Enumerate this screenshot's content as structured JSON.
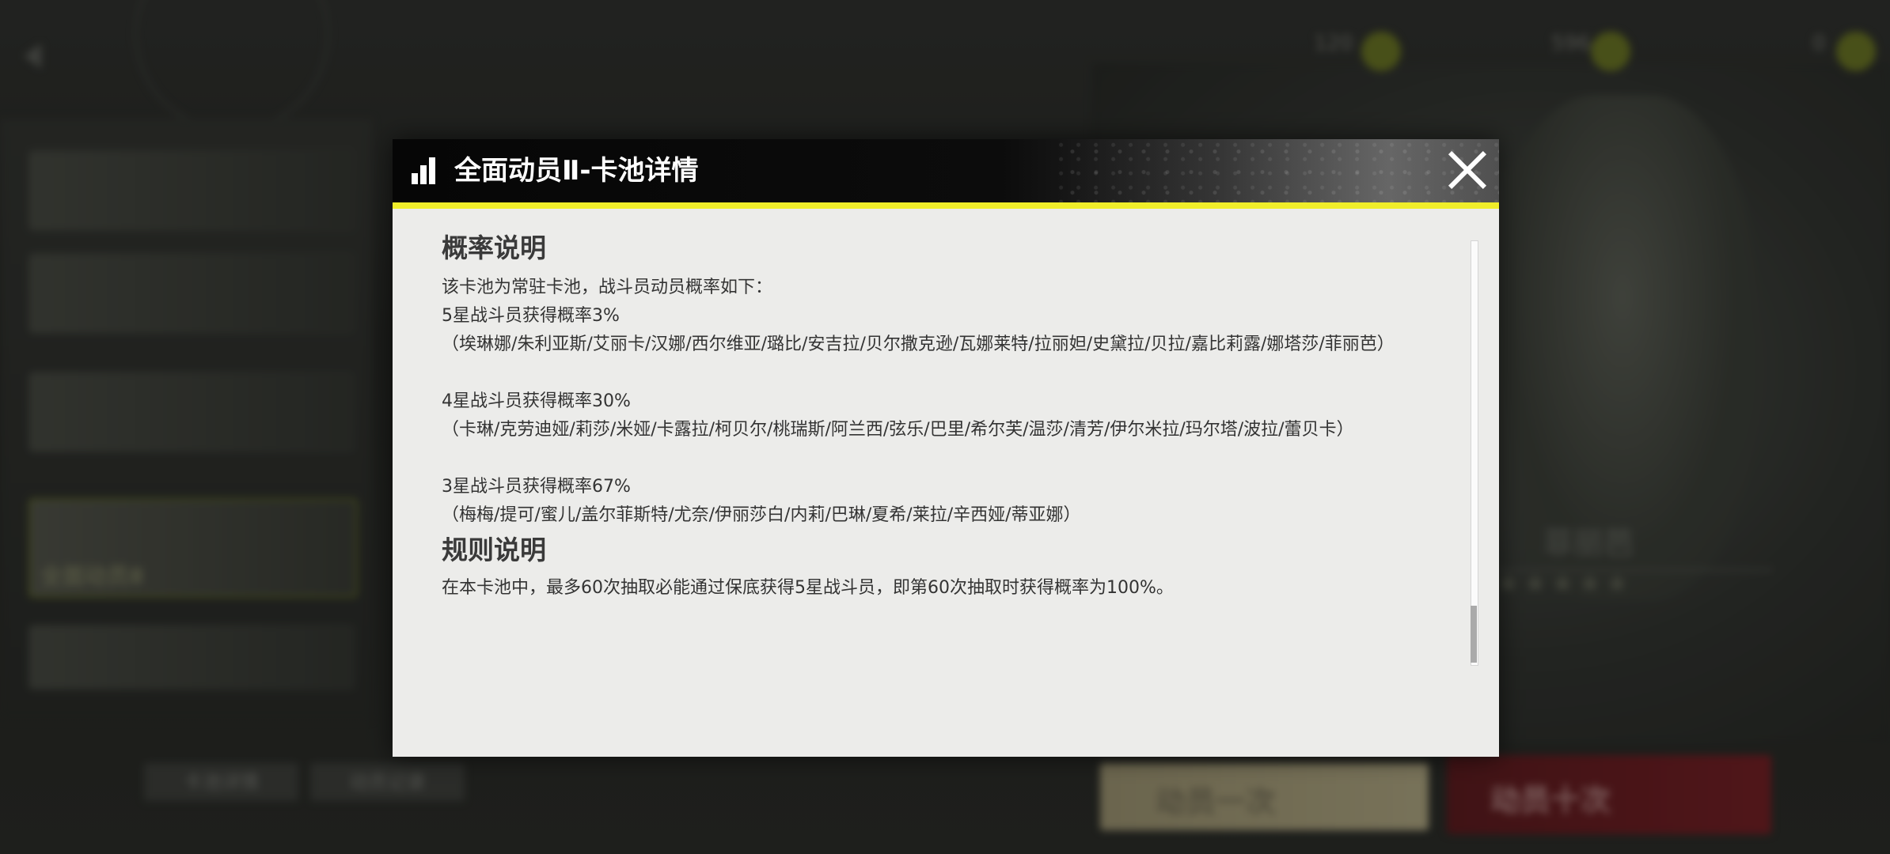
{
  "modal": {
    "title": "全面动员Ⅱ-卡池详情",
    "sections": [
      {
        "heading": "概率说明",
        "lines": [
          "该卡池为常驻卡池，战斗员动员概率如下：",
          "5星战斗员获得概率3%",
          "（埃琳娜/朱利亚斯/艾丽卡/汉娜/西尔维亚/璐比/安吉拉/贝尔撒克逊/瓦娜莱特/拉丽妲/史黛拉/贝拉/嘉比莉露/娜塔莎/菲丽芭）",
          "4星战斗员获得概率30%",
          "（卡琳/克劳迪娅/莉莎/米娅/卡露拉/柯贝尔/桃瑞斯/阿兰西/弦乐/巴里/希尔芙/温莎/清芳/伊尔米拉/玛尔塔/波拉/蕾贝卡）",
          "3星战斗员获得概率67%",
          "（梅梅/提可/蜜儿/盖尔菲斯特/尤奈/伊丽莎白/内莉/巴琳/夏希/莱拉/辛西娅/蒂亚娜）"
        ]
      },
      {
        "heading": "规则说明",
        "lines": [
          "在本卡池中，最多60次抽取必能通过保底获得5星战斗员，即第60次抽取时获得概率为100%。"
        ]
      }
    ],
    "scroll_position": 0.85
  },
  "background": {
    "currency": [
      "120",
      "596",
      "0"
    ],
    "banners": [
      "全面动员Ⅱ"
    ],
    "character_name": "菲丽芭",
    "tabs": [
      "卡池详情",
      "动员记录"
    ],
    "buttons": [
      "动员一次",
      "动员十次"
    ]
  },
  "colors": {
    "accent": "#f0ee2a",
    "header_bg": "#0a0a0a",
    "body_bg": "#ececea"
  }
}
